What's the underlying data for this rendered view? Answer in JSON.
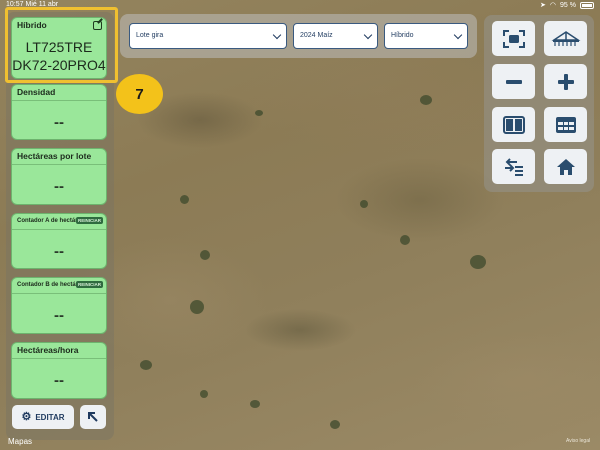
{
  "status_bar": {
    "time": "10:57",
    "date": "Mié 11 abr",
    "battery": "95 %"
  },
  "cards": {
    "hybrid": {
      "title": "Híbrido",
      "line1": "LT725TRE",
      "line2": "DK72-20PRO4"
    },
    "density": {
      "title": "Densidad",
      "value": "--"
    },
    "hectares_per_lot": {
      "title": "Hectáreas por lote",
      "value": "--"
    },
    "counter_a": {
      "title": "Contador A de hectáreas",
      "reset": "REINICIAR",
      "value": "--"
    },
    "counter_b": {
      "title": "Contador B de hectáreas",
      "reset": "REINICIAR",
      "value": "--"
    },
    "hectares_hour": {
      "title": "Hectáreas/hora",
      "value": "--"
    }
  },
  "buttons": {
    "edit_label": "EDITAR"
  },
  "step_badge": "7",
  "selectors": {
    "lot": "Lote gira",
    "season": "2024 Maíz",
    "hybrid": "Híbrido"
  },
  "map": {
    "attribution": "Mapas",
    "legal": "Aviso legal"
  },
  "tools": [
    "fit-screen-icon",
    "implement-icon",
    "zoom-out-icon",
    "zoom-in-icon",
    "split-view-icon",
    "table-view-icon",
    "swap-list-icon",
    "home-icon"
  ],
  "colors": {
    "card_green": "#9ae79a",
    "highlight_yellow": "#f0c030",
    "badge_yellow": "#f3c21a",
    "ui_blue": "#2a4d6e"
  }
}
